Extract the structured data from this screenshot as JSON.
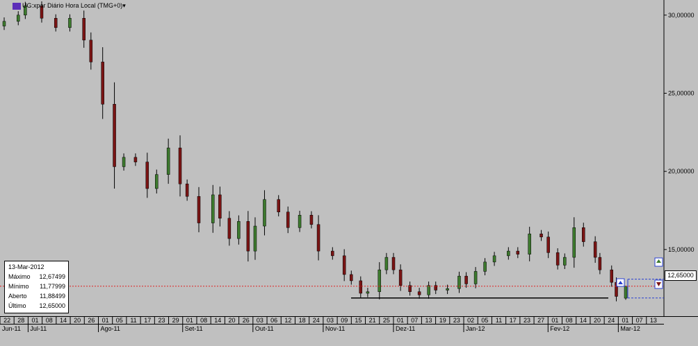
{
  "title": "UG:xpar Diário Hora Local (TMG+0)▾",
  "last_price_label": "12,65000",
  "info_panel": {
    "date": "13-Mar-2012",
    "rows": [
      {
        "label": "Máximo",
        "value": "12,67499"
      },
      {
        "label": "Mínimo",
        "value": "11,77999"
      },
      {
        "label": "Aberto",
        "value": "11,88499"
      },
      {
        "label": "Último",
        "value": "12,65000"
      }
    ]
  },
  "colors": {
    "background": "#c0c0c0",
    "up": "#3d7a2e",
    "down": "#7a1414",
    "support_line": "#000000",
    "last_price_line": "#e02020",
    "target_line": "#2a3fd0"
  },
  "chart_data": {
    "type": "candlestick",
    "ylim": [
      11.0,
      30.7
    ],
    "yticks": [
      {
        "value": 15,
        "label": "15,00000"
      },
      {
        "value": 20,
        "label": "20,00000"
      },
      {
        "value": 25,
        "label": "25,00000"
      },
      {
        "value": 30,
        "label": "30,00000"
      }
    ],
    "day_ticks": [
      "22",
      "28",
      "01",
      "08",
      "14",
      "20",
      "26",
      "01",
      "05",
      "11",
      "17",
      "23",
      "29",
      "01",
      "08",
      "14",
      "20",
      "26",
      "03",
      "06",
      "12",
      "18",
      "24",
      "03",
      "09",
      "15",
      "21",
      "25",
      "01",
      "07",
      "13",
      "19",
      "23",
      "02",
      "05",
      "11",
      "17",
      "23",
      "27",
      "01",
      "08",
      "14",
      "20",
      "24",
      "01",
      "07",
      "13"
    ],
    "month_labels": [
      "Jun-11",
      "Jul-11",
      "Ago-11",
      "Set-11",
      "Out-11",
      "Nov-11",
      "Dez-11",
      "Jan-12",
      "Fev-12",
      "Mar-12"
    ],
    "anchors": [
      {
        "date": "2011-06-22",
        "close": 29.6
      },
      {
        "date": "2011-06-28",
        "close": 30.0
      },
      {
        "date": "2011-07-01",
        "close": 30.6
      },
      {
        "date": "2011-07-08",
        "close": 29.8
      },
      {
        "date": "2011-07-14",
        "close": 29.2
      },
      {
        "date": "2011-07-20",
        "close": 29.8
      },
      {
        "date": "2011-07-26",
        "close": 28.4
      },
      {
        "date": "2011-07-29",
        "close": 27.0
      },
      {
        "date": "2011-08-03",
        "close": 24.3
      },
      {
        "date": "2011-08-08",
        "close": 20.3
      },
      {
        "date": "2011-08-12",
        "close": 20.9
      },
      {
        "date": "2011-08-17",
        "close": 20.6
      },
      {
        "date": "2011-08-22",
        "close": 18.9
      },
      {
        "date": "2011-08-26",
        "close": 19.8
      },
      {
        "date": "2011-08-31",
        "close": 21.5
      },
      {
        "date": "2011-09-05",
        "close": 19.2
      },
      {
        "date": "2011-09-08",
        "close": 18.4
      },
      {
        "date": "2011-09-13",
        "close": 16.7
      },
      {
        "date": "2011-09-19",
        "close": 18.5
      },
      {
        "date": "2011-09-22",
        "close": 17.0
      },
      {
        "date": "2011-09-26",
        "close": 15.7
      },
      {
        "date": "2011-09-30",
        "close": 16.8
      },
      {
        "date": "2011-10-04",
        "close": 14.9
      },
      {
        "date": "2011-10-07",
        "close": 16.5
      },
      {
        "date": "2011-10-11",
        "close": 18.2
      },
      {
        "date": "2011-10-17",
        "close": 17.4
      },
      {
        "date": "2011-10-21",
        "close": 16.4
      },
      {
        "date": "2011-10-26",
        "close": 17.2
      },
      {
        "date": "2011-10-31",
        "close": 16.6
      },
      {
        "date": "2011-11-03",
        "close": 14.9
      },
      {
        "date": "2011-11-09",
        "close": 14.6
      },
      {
        "date": "2011-11-14",
        "close": 13.4
      },
      {
        "date": "2011-11-17",
        "close": 13.0
      },
      {
        "date": "2011-11-21",
        "close": 12.2
      },
      {
        "date": "2011-11-24",
        "close": 12.3
      },
      {
        "date": "2011-11-29",
        "close": 13.7
      },
      {
        "date": "2011-12-02",
        "close": 14.5
      },
      {
        "date": "2011-12-05",
        "close": 13.7
      },
      {
        "date": "2011-12-08",
        "close": 12.7
      },
      {
        "date": "2011-12-12",
        "close": 12.3
      },
      {
        "date": "2011-12-16",
        "close": 12.1
      },
      {
        "date": "2011-12-20",
        "close": 12.7
      },
      {
        "date": "2011-12-23",
        "close": 12.4
      },
      {
        "date": "2011-12-28",
        "close": 12.5
      },
      {
        "date": "2012-01-02",
        "close": 13.3
      },
      {
        "date": "2012-01-05",
        "close": 12.8
      },
      {
        "date": "2012-01-09",
        "close": 13.6
      },
      {
        "date": "2012-01-13",
        "close": 14.2
      },
      {
        "date": "2012-01-17",
        "close": 14.6
      },
      {
        "date": "2012-01-23",
        "close": 14.9
      },
      {
        "date": "2012-01-27",
        "close": 14.7
      },
      {
        "date": "2012-02-01",
        "close": 16.0
      },
      {
        "date": "2012-02-06",
        "close": 15.8
      },
      {
        "date": "2012-02-09",
        "close": 14.8
      },
      {
        "date": "2012-02-13",
        "close": 14.0
      },
      {
        "date": "2012-02-16",
        "close": 14.5
      },
      {
        "date": "2012-02-20",
        "close": 16.4
      },
      {
        "date": "2012-02-24",
        "close": 15.5
      },
      {
        "date": "2012-02-29",
        "close": 14.5
      },
      {
        "date": "2012-03-02",
        "close": 13.7
      },
      {
        "date": "2012-03-07",
        "close": 12.9
      },
      {
        "date": "2012-03-09",
        "close": 12.0
      },
      {
        "date": "2012-03-13",
        "close": 12.65
      }
    ],
    "last": {
      "date": "2012-03-13",
      "open": 11.88499,
      "high": 12.67499,
      "low": 11.77999,
      "close": 12.65
    },
    "support_level": 11.9,
    "last_price": 12.65,
    "target_upper": 13.1,
    "target_lower": 11.9
  }
}
